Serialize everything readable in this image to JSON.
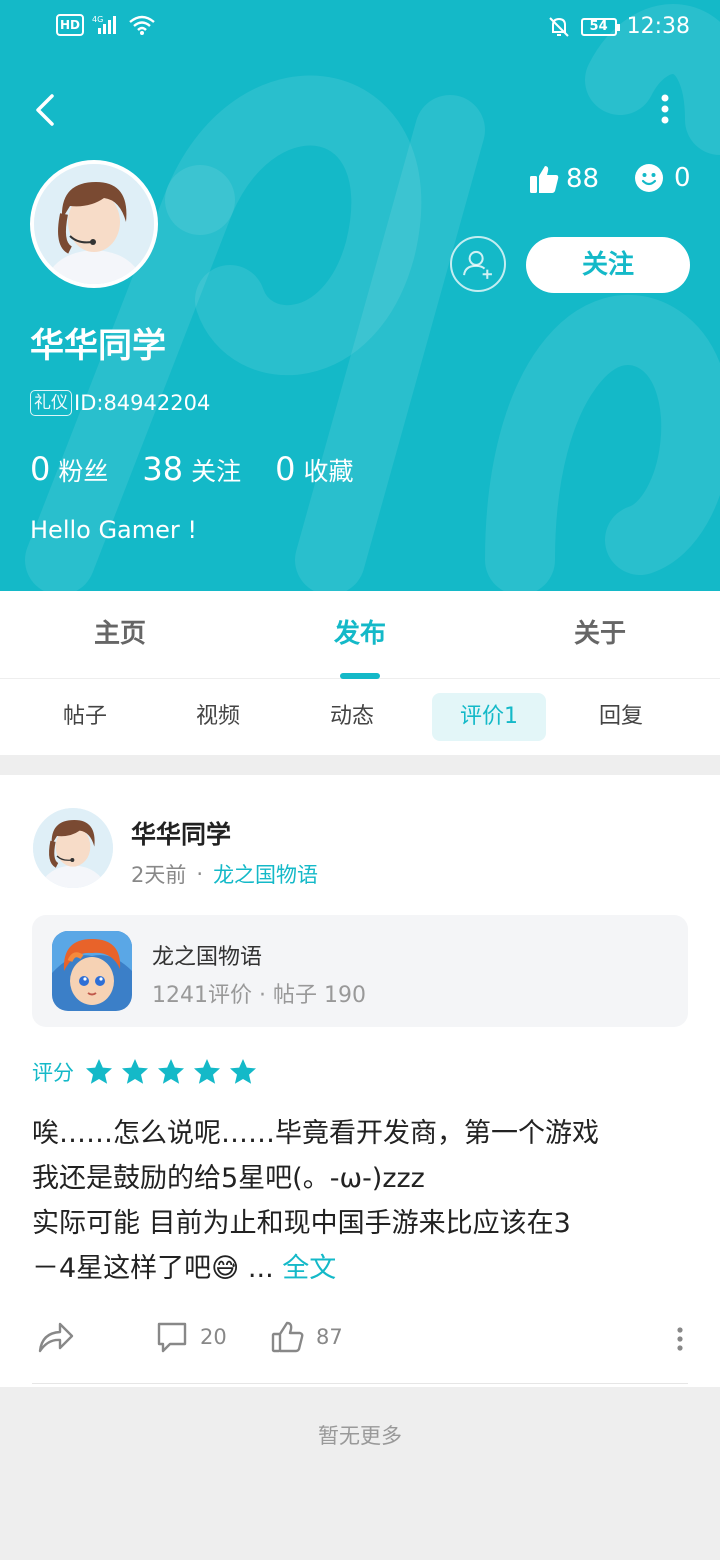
{
  "status_bar": {
    "hd": "HD",
    "network": "4G",
    "battery": "54",
    "time": "12:38"
  },
  "profile": {
    "name": "华华同学",
    "id_badge": "礼仪",
    "id_text": "ID:84942204",
    "likes": "88",
    "smiles": "0",
    "follow_label": "关注",
    "fans_count": "0",
    "fans_label": "粉丝",
    "following_count": "38",
    "following_label": "关注",
    "favorites_count": "0",
    "favorites_label": "收藏",
    "bio": "Hello Gamer !"
  },
  "main_tabs": [
    {
      "label": "主页"
    },
    {
      "label": "发布"
    },
    {
      "label": "关于"
    }
  ],
  "active_main_tab": "发布",
  "sub_tabs": [
    {
      "label": "帖子"
    },
    {
      "label": "视频"
    },
    {
      "label": "动态"
    },
    {
      "label": "评价1"
    },
    {
      "label": "回复"
    }
  ],
  "active_sub_tab": "评价1",
  "post": {
    "author": "华华同学",
    "time_ago": "2天前",
    "dot": "·",
    "game_tag": "龙之国物语",
    "game": {
      "name": "龙之国物语",
      "stats": "1241评价 · 帖子 190"
    },
    "rating_label": "评分",
    "rating_stars": 5,
    "review": "唉……怎么说呢……毕竟看开发商，第一个游戏\n我还是鼓励的给5星吧(。-ω-)zzz\n实际可能 目前为止和现中国手游来比应该在3\n－4星这样了吧😅 ... ",
    "full_text_link": "全文",
    "comments": "20",
    "likes": "87"
  },
  "footer": "暂无更多",
  "colors": {
    "accent": "#14b9c8",
    "header_bg": "#14b9c8",
    "page_bg": "#eeeeee"
  },
  "icons": [
    "back-icon",
    "more-vertical-icon",
    "thumbs-up-icon",
    "smile-icon",
    "add-friend-icon",
    "share-icon",
    "comment-icon",
    "like-icon",
    "star-icon"
  ]
}
